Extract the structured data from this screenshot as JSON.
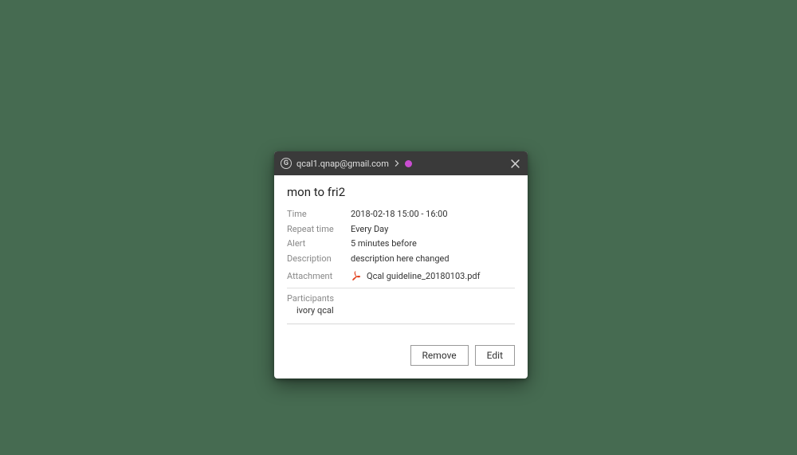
{
  "header": {
    "account": "qcal1.qnap@gmail.com",
    "calendar_color": "#c94dd1"
  },
  "event": {
    "title": "mon to fri2",
    "details": {
      "time_label": "Time",
      "time_value": "2018-02-18 15:00 - 16:00",
      "repeat_label": "Repeat time",
      "repeat_value": "Every Day",
      "alert_label": "Alert",
      "alert_value": "5 minutes before",
      "description_label": "Description",
      "description_value": "description here changed"
    },
    "attachment": {
      "label": "Attachment",
      "filename": "Qcal guideline_20180103.pdf"
    },
    "participants": {
      "label": "Participants",
      "names": [
        "ivory qcal"
      ]
    }
  },
  "buttons": {
    "remove": "Remove",
    "edit": "Edit"
  }
}
